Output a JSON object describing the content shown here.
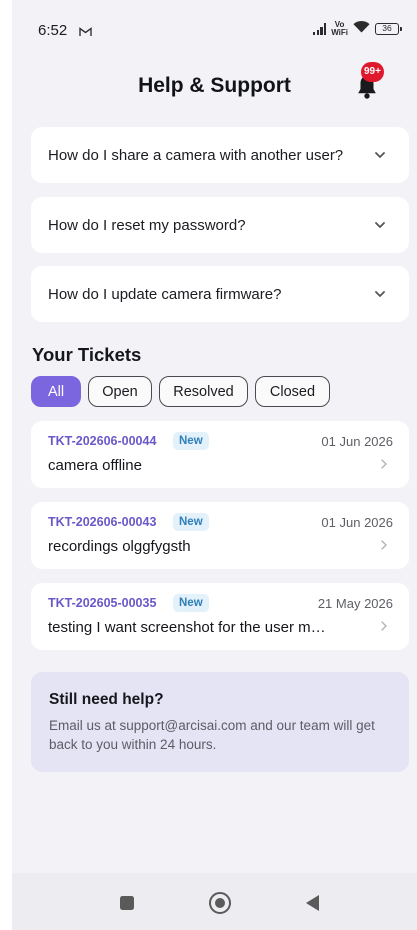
{
  "status_bar": {
    "time": "6:52",
    "network": "Vo\nWiFi",
    "battery": "36",
    "mail_icon": "gmail-icon",
    "signal_icon": "signal-bars-icon",
    "wifi_icon": "wifi-icon",
    "battery_icon": "battery-icon"
  },
  "header": {
    "title": "Help & Support",
    "bell_icon": "bell-icon",
    "notification_count": "99+"
  },
  "faq": [
    {
      "question": "How do I share a camera with another user?"
    },
    {
      "question": "How do I reset my password?"
    },
    {
      "question": "How do I update camera firmware?"
    }
  ],
  "tickets_section": {
    "title": "Your Tickets",
    "filters": [
      {
        "label": "All",
        "active": true
      },
      {
        "label": "Open",
        "active": false
      },
      {
        "label": "Resolved",
        "active": false
      },
      {
        "label": "Closed",
        "active": false
      }
    ],
    "tickets": [
      {
        "id": "TKT-202606-00044",
        "status": "New",
        "date": "01 Jun 2026",
        "subject": "camera offline"
      },
      {
        "id": "TKT-202606-00043",
        "status": "New",
        "date": "01 Jun 2026",
        "subject": "recordings olggfygsth"
      },
      {
        "id": "TKT-202605-00035",
        "status": "New",
        "date": "21 May 2026",
        "subject": "testing I want screenshot for the user m…"
      }
    ]
  },
  "help_box": {
    "title": "Still need help?",
    "text": "Email us at support@arcisai.com and our team will get back to you within 24 hours."
  },
  "colors": {
    "accent": "#7b66e0",
    "ticket_id": "#6b58c8",
    "status_bg": "#e3f1fb",
    "status_text": "#2f7fb8",
    "badge": "#e0182d",
    "help_bg": "#e5e4f4",
    "page_bg": "#f3f3f7"
  },
  "navigation": {
    "recents_icon": "square-recents-icon",
    "home_icon": "circle-home-icon",
    "back_icon": "triangle-back-icon"
  }
}
